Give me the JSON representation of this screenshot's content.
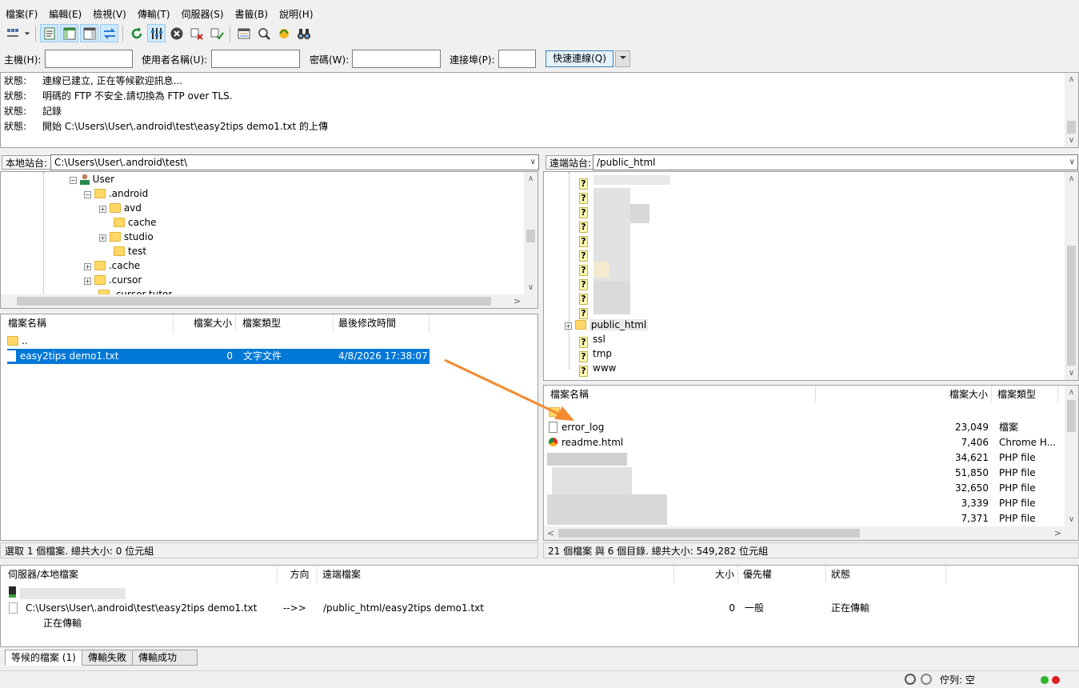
{
  "menu": [
    "檔案(F)",
    "編輯(E)",
    "檢視(V)",
    "傳輸(T)",
    "伺服器(S)",
    "書籤(B)",
    "說明(H)"
  ],
  "toolbar_icons": [
    "site-manager-icon",
    "dropdown-arrow-icon",
    "message-log-icon",
    "local-tree-icon",
    "remote-tree-icon",
    "transfer-queue-icon",
    "refresh-icon",
    "filter-icon",
    "cancel-icon",
    "disconnect-icon",
    "reconnect-icon",
    "compare-icon",
    "sync-browse-icon",
    "search-files-icon",
    "binoculars-icon"
  ],
  "quickconnect": {
    "host_label": "主機(H):",
    "user_label": "使用者名稱(U):",
    "pass_label": "密碼(W):",
    "port_label": "連接埠(P):",
    "button_label": "快速連線(Q)"
  },
  "log": [
    {
      "k": "狀態:",
      "v": "連線已建立, 正在等候歡迎訊息..."
    },
    {
      "k": "狀態:",
      "v": "明碼的 FTP 不安全.請切換為 FTP over TLS."
    },
    {
      "k": "狀態:",
      "v": "記錄"
    },
    {
      "k": "狀態:",
      "v": "開始 C:\\Users\\User\\.android\\test\\easy2tips demo1.txt 的上傳"
    }
  ],
  "local": {
    "label": "本地站台:",
    "path": "C:\\Users\\User\\.android\\test\\",
    "tree": [
      "User",
      ".android",
      "avd",
      "cache",
      "studio",
      "test",
      ".cache",
      ".cursor",
      ".cursor-tutor"
    ],
    "headers": [
      "檔案名稱",
      "檔案大小",
      "檔案類型",
      "最後修改時間"
    ],
    "parent": "..",
    "file": {
      "name": "easy2tips demo1.txt",
      "size": "0",
      "type": "文字文件",
      "mtime": "4/8/2026 17:38:07"
    },
    "status": "選取 1 個檔案. 總共大小: 0 位元組"
  },
  "remote": {
    "label": "遠端站台:",
    "path": "/public_html",
    "tree": [
      "public_html",
      "ssl",
      "tmp",
      "www"
    ],
    "headers": [
      "檔案名稱",
      "檔案大小",
      "檔案類型"
    ],
    "files": [
      {
        "name": "error_log",
        "size": "23,049",
        "type": "檔案"
      },
      {
        "name": "readme.html",
        "size": "7,406",
        "type": "Chrome H..."
      },
      {
        "name": "",
        "size": "34,621",
        "type": "PHP file"
      },
      {
        "name": "",
        "size": "51,850",
        "type": "PHP file"
      },
      {
        "name": "",
        "size": "32,650",
        "type": "PHP file"
      },
      {
        "name": "",
        "size": "3,339",
        "type": "PHP file"
      },
      {
        "name": "",
        "size": "7,371",
        "type": "PHP file"
      }
    ],
    "status": "21 個檔案 與 6 個目錄. 總共大小: 549,282 位元組"
  },
  "queue": {
    "headers": [
      "伺服器/本地檔案",
      "方向",
      "遠端檔案",
      "大小",
      "優先權",
      "狀態"
    ],
    "item": {
      "local": "C:\\Users\\User\\.android\\test\\easy2tips demo1.txt",
      "dir": "-->>",
      "remote": "/public_html/easy2tips demo1.txt",
      "size": "0",
      "priority": "一般",
      "status": "正在傳輸",
      "sub": "正在傳輸"
    },
    "tabs": [
      "等候的檔案 (1)",
      "傳輸失敗",
      "傳輸成功"
    ]
  },
  "statusbar": {
    "queue_text": "佇列: 空"
  },
  "colors": {
    "selection": "#0078d7",
    "arrow": "#f28a30",
    "accent": "#3c7fb1"
  }
}
